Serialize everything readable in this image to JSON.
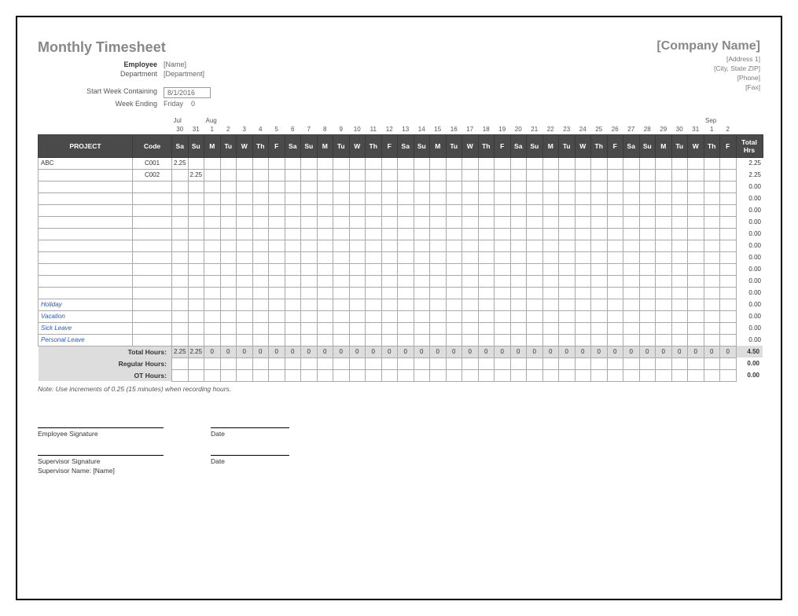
{
  "title": "Monthly Timesheet",
  "company": {
    "name": "[Company Name]",
    "addr1": "[Address 1]",
    "addr2": "[City, State ZIP]",
    "phone": "[Phone]",
    "fax": "[Fax]"
  },
  "meta": {
    "employee_lbl": "Employee",
    "employee_val": "[Name]",
    "dept_lbl": "Department",
    "dept_val": "[Department]",
    "start_lbl": "Start Week Containing",
    "start_val": "8/1/2016",
    "we_lbl": "Week Ending",
    "we_val": "Friday",
    "we_num": "0"
  },
  "months": {
    "jul": "Jul",
    "aug": "Aug",
    "sep": "Sep"
  },
  "days_num": [
    "30",
    "31",
    "1",
    "2",
    "3",
    "4",
    "5",
    "6",
    "7",
    "8",
    "9",
    "10",
    "11",
    "12",
    "13",
    "14",
    "15",
    "16",
    "17",
    "18",
    "19",
    "20",
    "21",
    "22",
    "23",
    "24",
    "25",
    "26",
    "27",
    "28",
    "29",
    "30",
    "31",
    "1",
    "2"
  ],
  "days_dow": [
    "Sa",
    "Su",
    "M",
    "Tu",
    "W",
    "Th",
    "F",
    "Sa",
    "Su",
    "M",
    "Tu",
    "W",
    "Th",
    "F",
    "Sa",
    "Su",
    "M",
    "Tu",
    "W",
    "Th",
    "F",
    "Sa",
    "Su",
    "M",
    "Tu",
    "W",
    "Th",
    "F",
    "Sa",
    "Su",
    "M",
    "Tu",
    "W",
    "Th",
    "F"
  ],
  "col_hdr": {
    "project": "PROJECT",
    "code": "Code",
    "total": "Total Hrs"
  },
  "rows": [
    {
      "project": "ABC",
      "code": "C001",
      "cells": [
        "2.25",
        "",
        "",
        "",
        "",
        "",
        "",
        "",
        "",
        "",
        "",
        "",
        "",
        "",
        "",
        "",
        "",
        "",
        "",
        "",
        "",
        "",
        "",
        "",
        "",
        "",
        "",
        "",
        "",
        "",
        "",
        "",
        "",
        "",
        ""
      ],
      "total": "2.25",
      "cat": false
    },
    {
      "project": "",
      "code": "C002",
      "cells": [
        "",
        "2.25",
        "",
        "",
        "",
        "",
        "",
        "",
        "",
        "",
        "",
        "",
        "",
        "",
        "",
        "",
        "",
        "",
        "",
        "",
        "",
        "",
        "",
        "",
        "",
        "",
        "",
        "",
        "",
        "",
        "",
        "",
        "",
        "",
        ""
      ],
      "total": "2.25",
      "cat": false
    },
    {
      "project": "",
      "code": "",
      "cells": [],
      "total": "0.00",
      "cat": false
    },
    {
      "project": "",
      "code": "",
      "cells": [],
      "total": "0.00",
      "cat": false
    },
    {
      "project": "",
      "code": "",
      "cells": [],
      "total": "0.00",
      "cat": false
    },
    {
      "project": "",
      "code": "",
      "cells": [],
      "total": "0.00",
      "cat": false
    },
    {
      "project": "",
      "code": "",
      "cells": [],
      "total": "0.00",
      "cat": false
    },
    {
      "project": "",
      "code": "",
      "cells": [],
      "total": "0.00",
      "cat": false
    },
    {
      "project": "",
      "code": "",
      "cells": [],
      "total": "0.00",
      "cat": false
    },
    {
      "project": "",
      "code": "",
      "cells": [],
      "total": "0.00",
      "cat": false
    },
    {
      "project": "",
      "code": "",
      "cells": [],
      "total": "0.00",
      "cat": false
    },
    {
      "project": "",
      "code": "",
      "cells": [],
      "total": "0.00",
      "cat": false
    },
    {
      "project": "Holiday",
      "code": "",
      "cells": [],
      "total": "0.00",
      "cat": true
    },
    {
      "project": "Vacation",
      "code": "",
      "cells": [],
      "total": "0.00",
      "cat": true
    },
    {
      "project": "Sick Leave",
      "code": "",
      "cells": [],
      "total": "0.00",
      "cat": true
    },
    {
      "project": "Personal Leave",
      "code": "",
      "cells": [],
      "total": "0.00",
      "cat": true
    }
  ],
  "totals": {
    "th_lbl": "Total Hours:",
    "th_cells": [
      "2.25",
      "2.25",
      "0",
      "0",
      "0",
      "0",
      "0",
      "0",
      "0",
      "0",
      "0",
      "0",
      "0",
      "0",
      "0",
      "0",
      "0",
      "0",
      "0",
      "0",
      "0",
      "0",
      "0",
      "0",
      "0",
      "0",
      "0",
      "0",
      "0",
      "0",
      "0",
      "0",
      "0",
      "0",
      "0"
    ],
    "th_total": "4.50",
    "reg_lbl": "Regular Hours:",
    "reg_cells": [],
    "reg_total": "0.00",
    "ot_lbl": "OT Hours:",
    "ot_cells": [],
    "ot_total": "0.00"
  },
  "note": "Note: Use increments of 0.25 (15 minutes) when recording hours.",
  "sign": {
    "emp": "Employee Signature",
    "sup": "Supervisor Signature",
    "date": "Date",
    "sup_name_lbl": "Supervisor Name:",
    "sup_name_val": "[Name]"
  }
}
